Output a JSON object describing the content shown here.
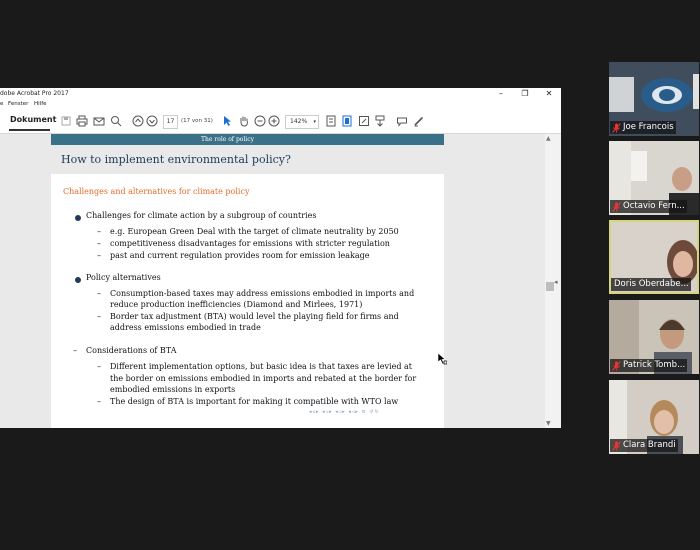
{
  "acrobat": {
    "title": "dobe Acrobat Pro 2017",
    "menu": [
      "e",
      "Fenster",
      "Hilfe"
    ],
    "tab_label": "Dokument",
    "page_number": "17",
    "page_count": "(17 von 31)",
    "zoom": "142%"
  },
  "slide": {
    "section": "The role of policy",
    "title": "How to implement environmental policy?",
    "block_title": "Challenges and alternatives for climate policy",
    "lines": {
      "b1": "Challenges for climate action by a subgroup of countries",
      "b1s1": "e.g.  European Green Deal with the target of climate neutrality by 2050",
      "b1s2": "competitiveness disadvantages for emissions with stricter regulation",
      "b1s3": "past and current regulation provides room for emission leakage",
      "b2": "Policy alternatives",
      "b2s1a": "Consumption-based taxes may address emissions embodied in imports and",
      "b2s1b": "reduce production inefficiencies (Diamond and Mirlees, 1971)",
      "b2s2a": "Border tax adjustment (BTA) would level the playing field for firms and",
      "b2s2b": "address emissions embodied in trade",
      "b3": "Considerations of BTA",
      "b3s1a": "Different implementation options, but basic idea is that taxes are levied at",
      "b3s1b": "the border on emissions embodied in imports and rebated at the border for",
      "b3s1c": "embodied emissions in exports",
      "b3s2": "The design of BTA is important for making it compatible with WTO law"
    }
  },
  "participants": [
    {
      "name": "Joe Francois"
    },
    {
      "name": "Octavio Fern..."
    },
    {
      "name": "Doris Oberdabe..."
    },
    {
      "name": "Patrick Tomb..."
    },
    {
      "name": "Clara Brandi"
    }
  ],
  "colors": {
    "section_bar": "#3a7088",
    "block_title": "#e46c2b",
    "active_speaker_border": "#d5d67a"
  }
}
